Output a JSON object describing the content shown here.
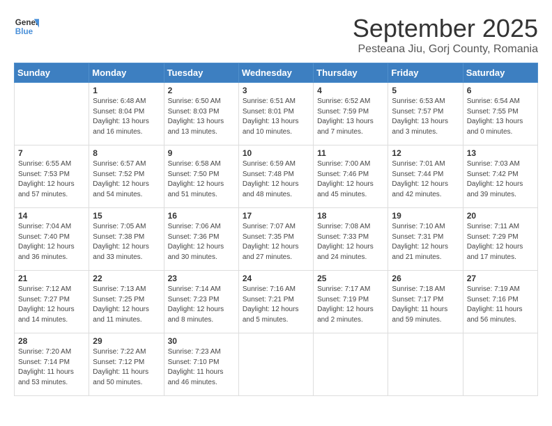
{
  "logo": {
    "general": "General",
    "blue": "Blue"
  },
  "header": {
    "month": "September 2025",
    "location": "Pesteana Jiu, Gorj County, Romania"
  },
  "weekdays": [
    "Sunday",
    "Monday",
    "Tuesday",
    "Wednesday",
    "Thursday",
    "Friday",
    "Saturday"
  ],
  "weeks": [
    [
      {
        "day": "",
        "sunrise": "",
        "sunset": "",
        "daylight": ""
      },
      {
        "day": "1",
        "sunrise": "Sunrise: 6:48 AM",
        "sunset": "Sunset: 8:04 PM",
        "daylight": "Daylight: 13 hours and 16 minutes."
      },
      {
        "day": "2",
        "sunrise": "Sunrise: 6:50 AM",
        "sunset": "Sunset: 8:03 PM",
        "daylight": "Daylight: 13 hours and 13 minutes."
      },
      {
        "day": "3",
        "sunrise": "Sunrise: 6:51 AM",
        "sunset": "Sunset: 8:01 PM",
        "daylight": "Daylight: 13 hours and 10 minutes."
      },
      {
        "day": "4",
        "sunrise": "Sunrise: 6:52 AM",
        "sunset": "Sunset: 7:59 PM",
        "daylight": "Daylight: 13 hours and 7 minutes."
      },
      {
        "day": "5",
        "sunrise": "Sunrise: 6:53 AM",
        "sunset": "Sunset: 7:57 PM",
        "daylight": "Daylight: 13 hours and 3 minutes."
      },
      {
        "day": "6",
        "sunrise": "Sunrise: 6:54 AM",
        "sunset": "Sunset: 7:55 PM",
        "daylight": "Daylight: 13 hours and 0 minutes."
      }
    ],
    [
      {
        "day": "7",
        "sunrise": "Sunrise: 6:55 AM",
        "sunset": "Sunset: 7:53 PM",
        "daylight": "Daylight: 12 hours and 57 minutes."
      },
      {
        "day": "8",
        "sunrise": "Sunrise: 6:57 AM",
        "sunset": "Sunset: 7:52 PM",
        "daylight": "Daylight: 12 hours and 54 minutes."
      },
      {
        "day": "9",
        "sunrise": "Sunrise: 6:58 AM",
        "sunset": "Sunset: 7:50 PM",
        "daylight": "Daylight: 12 hours and 51 minutes."
      },
      {
        "day": "10",
        "sunrise": "Sunrise: 6:59 AM",
        "sunset": "Sunset: 7:48 PM",
        "daylight": "Daylight: 12 hours and 48 minutes."
      },
      {
        "day": "11",
        "sunrise": "Sunrise: 7:00 AM",
        "sunset": "Sunset: 7:46 PM",
        "daylight": "Daylight: 12 hours and 45 minutes."
      },
      {
        "day": "12",
        "sunrise": "Sunrise: 7:01 AM",
        "sunset": "Sunset: 7:44 PM",
        "daylight": "Daylight: 12 hours and 42 minutes."
      },
      {
        "day": "13",
        "sunrise": "Sunrise: 7:03 AM",
        "sunset": "Sunset: 7:42 PM",
        "daylight": "Daylight: 12 hours and 39 minutes."
      }
    ],
    [
      {
        "day": "14",
        "sunrise": "Sunrise: 7:04 AM",
        "sunset": "Sunset: 7:40 PM",
        "daylight": "Daylight: 12 hours and 36 minutes."
      },
      {
        "day": "15",
        "sunrise": "Sunrise: 7:05 AM",
        "sunset": "Sunset: 7:38 PM",
        "daylight": "Daylight: 12 hours and 33 minutes."
      },
      {
        "day": "16",
        "sunrise": "Sunrise: 7:06 AM",
        "sunset": "Sunset: 7:36 PM",
        "daylight": "Daylight: 12 hours and 30 minutes."
      },
      {
        "day": "17",
        "sunrise": "Sunrise: 7:07 AM",
        "sunset": "Sunset: 7:35 PM",
        "daylight": "Daylight: 12 hours and 27 minutes."
      },
      {
        "day": "18",
        "sunrise": "Sunrise: 7:08 AM",
        "sunset": "Sunset: 7:33 PM",
        "daylight": "Daylight: 12 hours and 24 minutes."
      },
      {
        "day": "19",
        "sunrise": "Sunrise: 7:10 AM",
        "sunset": "Sunset: 7:31 PM",
        "daylight": "Daylight: 12 hours and 21 minutes."
      },
      {
        "day": "20",
        "sunrise": "Sunrise: 7:11 AM",
        "sunset": "Sunset: 7:29 PM",
        "daylight": "Daylight: 12 hours and 17 minutes."
      }
    ],
    [
      {
        "day": "21",
        "sunrise": "Sunrise: 7:12 AM",
        "sunset": "Sunset: 7:27 PM",
        "daylight": "Daylight: 12 hours and 14 minutes."
      },
      {
        "day": "22",
        "sunrise": "Sunrise: 7:13 AM",
        "sunset": "Sunset: 7:25 PM",
        "daylight": "Daylight: 12 hours and 11 minutes."
      },
      {
        "day": "23",
        "sunrise": "Sunrise: 7:14 AM",
        "sunset": "Sunset: 7:23 PM",
        "daylight": "Daylight: 12 hours and 8 minutes."
      },
      {
        "day": "24",
        "sunrise": "Sunrise: 7:16 AM",
        "sunset": "Sunset: 7:21 PM",
        "daylight": "Daylight: 12 hours and 5 minutes."
      },
      {
        "day": "25",
        "sunrise": "Sunrise: 7:17 AM",
        "sunset": "Sunset: 7:19 PM",
        "daylight": "Daylight: 12 hours and 2 minutes."
      },
      {
        "day": "26",
        "sunrise": "Sunrise: 7:18 AM",
        "sunset": "Sunset: 7:17 PM",
        "daylight": "Daylight: 11 hours and 59 minutes."
      },
      {
        "day": "27",
        "sunrise": "Sunrise: 7:19 AM",
        "sunset": "Sunset: 7:16 PM",
        "daylight": "Daylight: 11 hours and 56 minutes."
      }
    ],
    [
      {
        "day": "28",
        "sunrise": "Sunrise: 7:20 AM",
        "sunset": "Sunset: 7:14 PM",
        "daylight": "Daylight: 11 hours and 53 minutes."
      },
      {
        "day": "29",
        "sunrise": "Sunrise: 7:22 AM",
        "sunset": "Sunset: 7:12 PM",
        "daylight": "Daylight: 11 hours and 50 minutes."
      },
      {
        "day": "30",
        "sunrise": "Sunrise: 7:23 AM",
        "sunset": "Sunset: 7:10 PM",
        "daylight": "Daylight: 11 hours and 46 minutes."
      },
      {
        "day": "",
        "sunrise": "",
        "sunset": "",
        "daylight": ""
      },
      {
        "day": "",
        "sunrise": "",
        "sunset": "",
        "daylight": ""
      },
      {
        "day": "",
        "sunrise": "",
        "sunset": "",
        "daylight": ""
      },
      {
        "day": "",
        "sunrise": "",
        "sunset": "",
        "daylight": ""
      }
    ]
  ]
}
